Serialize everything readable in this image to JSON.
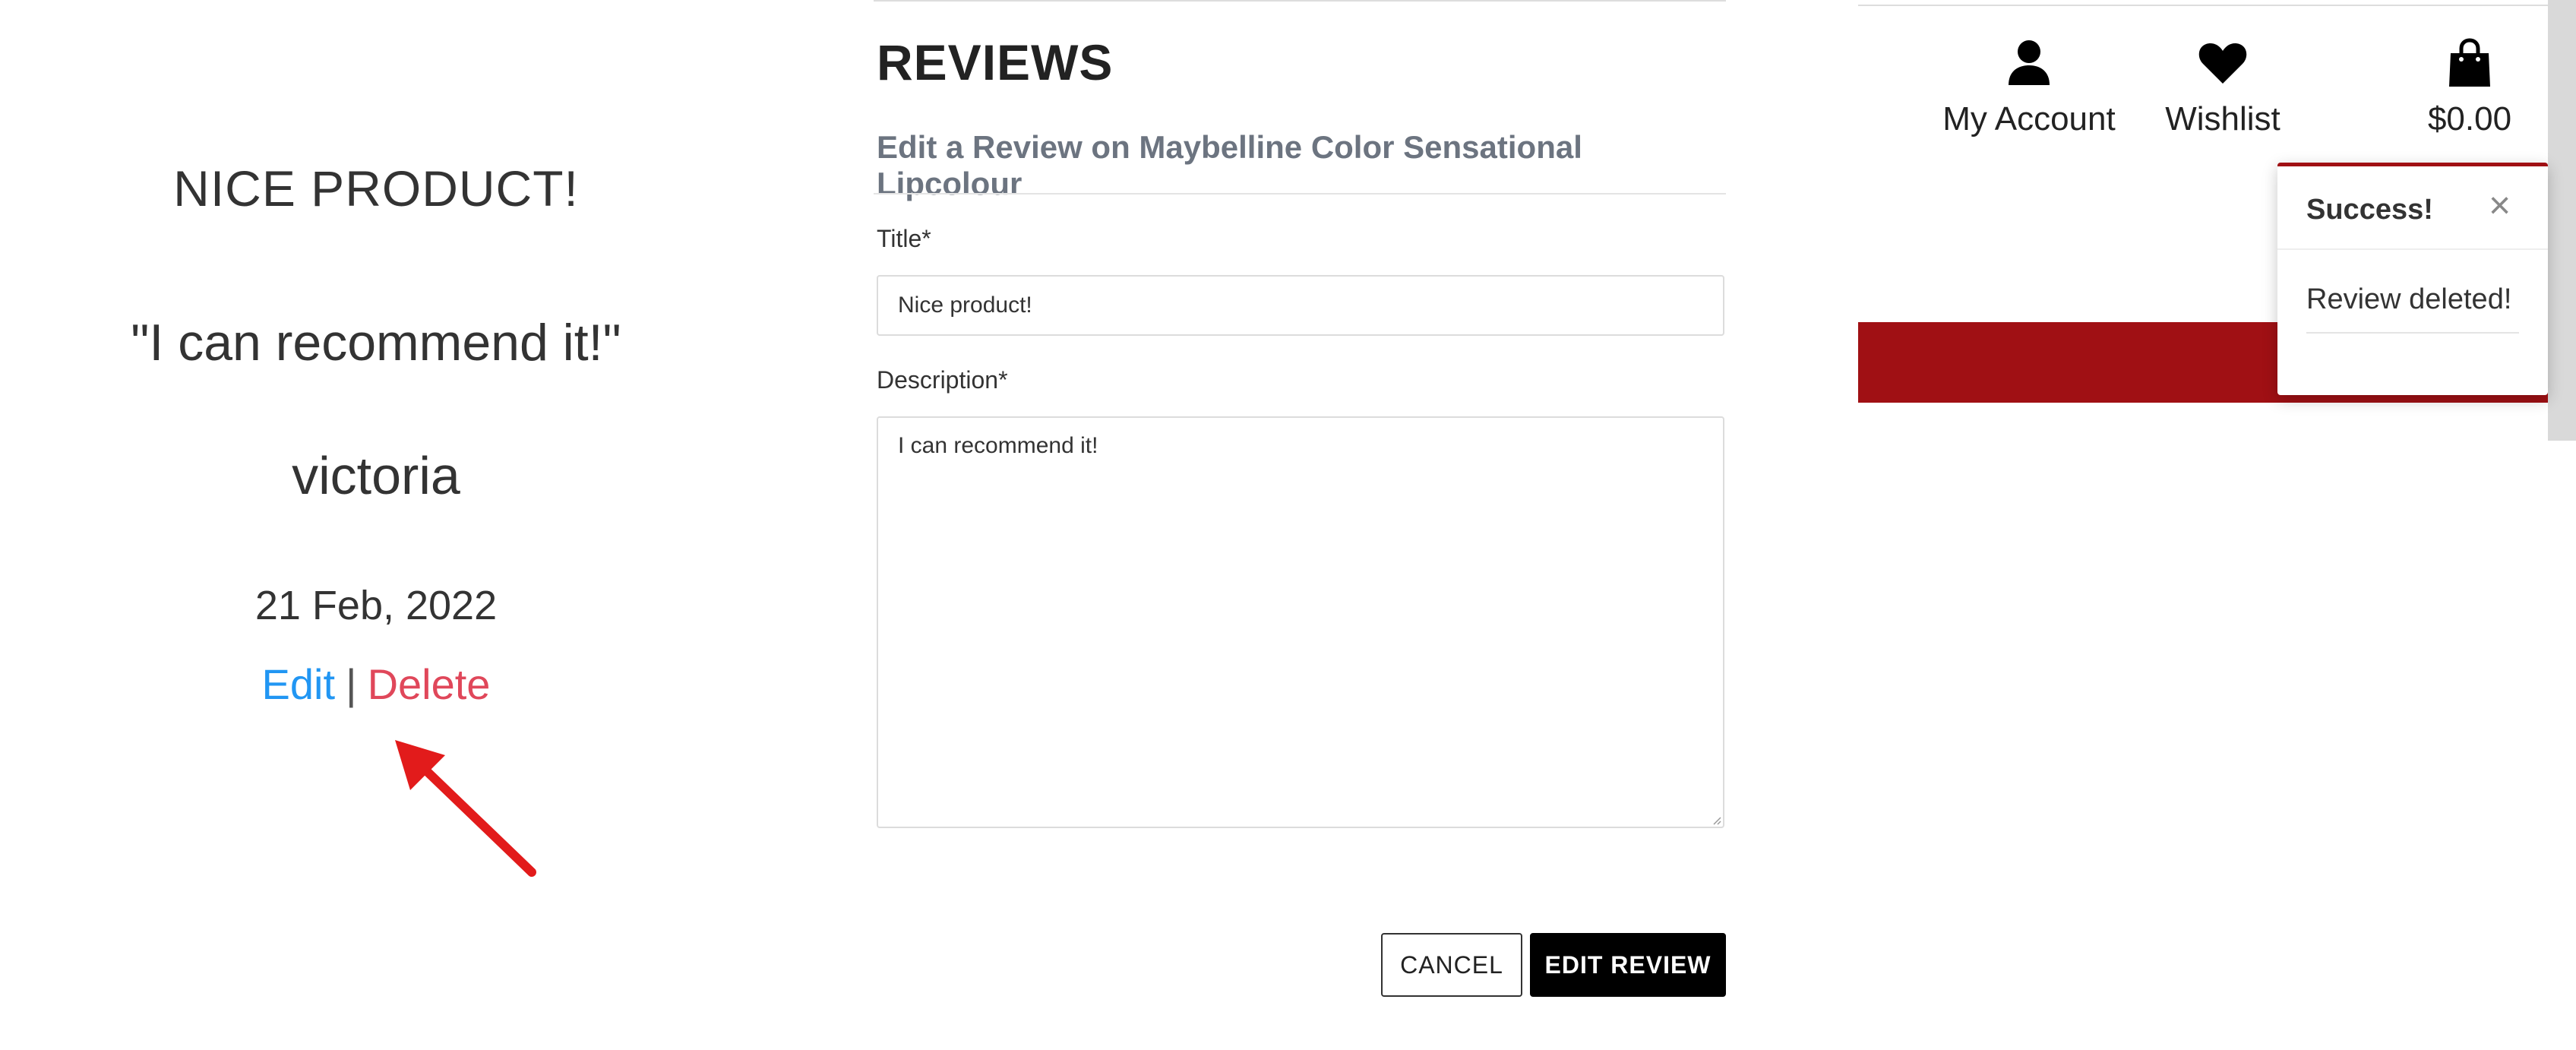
{
  "review": {
    "title": "NICE PRODUCT!",
    "quote": "\"I can recommend it!\"",
    "author": "victoria",
    "date": "21 Feb, 2022",
    "edit_label": "Edit",
    "separator": "|",
    "delete_label": "Delete"
  },
  "edit_form": {
    "heading": "REVIEWS",
    "subheading": "Edit a Review on Maybelline Color Sensational Lipcolour",
    "title_label": "Title*",
    "title_value": "Nice product!",
    "description_label": "Description*",
    "description_value": "I can recommend it!",
    "cancel_label": "CANCEL",
    "submit_label": "EDIT REVIEW"
  },
  "header": {
    "account_label": "My Account",
    "wishlist_label": "Wishlist",
    "bag_total": "$0.00",
    "icons": [
      "user-icon",
      "heart-icon",
      "shopping-bag-icon"
    ]
  },
  "toast": {
    "title": "Success!",
    "close_glyph": "×",
    "message": "Review deleted!"
  },
  "colors": {
    "brand_red": "#a01014",
    "edit_link": "#2196f3",
    "delete_link": "#e0475a",
    "annotation_arrow": "#e21b1b"
  }
}
